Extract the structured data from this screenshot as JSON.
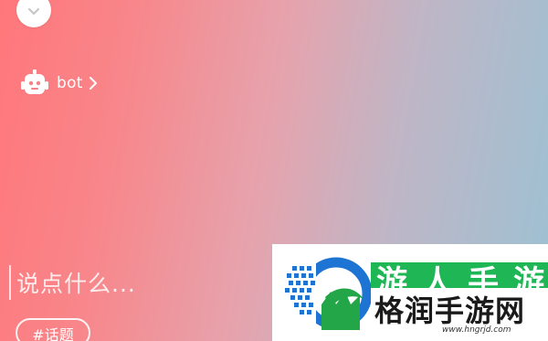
{
  "bot": {
    "label": "bot",
    "icon": "robot-icon",
    "chevron_icon": "chevron-right-icon"
  },
  "header": {
    "collapse_icon": "chevron-down-icon"
  },
  "composer": {
    "placeholder": "说点什么..."
  },
  "tag": {
    "label": "#话题"
  },
  "watermark": {
    "banner_text": "游人手游",
    "name": "格润手游网",
    "url": "www.hngrjd.com",
    "brand_green": "#1fb655"
  }
}
